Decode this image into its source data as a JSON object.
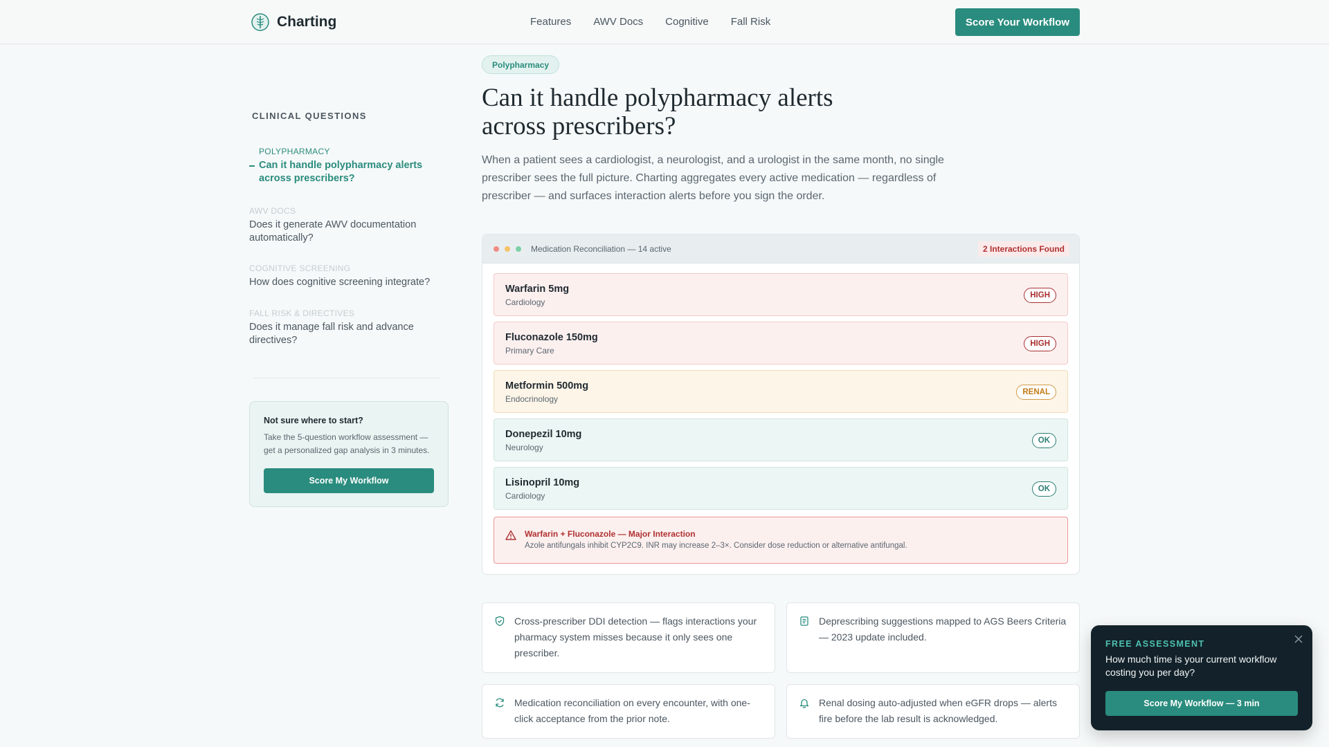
{
  "header": {
    "brand": "Charting",
    "nav": [
      "Features",
      "AWV Docs",
      "Cognitive",
      "Fall Risk"
    ],
    "cta": "Score Your Workflow"
  },
  "sidebar": {
    "heading": "CLINICAL QUESTIONS",
    "items": [
      {
        "category": "POLYPHARMACY",
        "question": "Can it handle polypharmacy alerts across prescribers?"
      },
      {
        "category": "AWV DOCS",
        "question": "Does it generate AWV documentation automatically?"
      },
      {
        "category": "COGNITIVE SCREENING",
        "question": "How does cognitive screening integrate?"
      },
      {
        "category": "FALL RISK & DIRECTIVES",
        "question": "Does it manage fall risk and advance directives?"
      }
    ],
    "help": {
      "title": "Not sure where to start?",
      "text": "Take the 5-question workflow assessment — get a personalized gap analysis in 3 minutes.",
      "button": "Score My Workflow"
    }
  },
  "main": {
    "tag": "Polypharmacy",
    "title": "Can it handle polypharmacy alerts across prescribers?",
    "lead": "When a patient sees a cardiologist, a neurologist, and a urologist in the same month, no single prescriber sees the full picture. Charting aggregates every active medication — regardless of prescriber — and surfaces interaction alerts before you sign the order.",
    "window": {
      "title": "Medication Reconciliation — 14 active",
      "interactions": "2 Interactions Found",
      "dot_colors": [
        "#f28b82",
        "#f6c26b",
        "#7fd0a8"
      ],
      "meds": [
        {
          "name": "Warfarin 5mg",
          "specialty": "Cardiology",
          "badge": "HIGH",
          "level": "high"
        },
        {
          "name": "Fluconazole 150mg",
          "specialty": "Primary Care",
          "badge": "HIGH",
          "level": "high"
        },
        {
          "name": "Metformin 500mg",
          "specialty": "Endocrinology",
          "badge": "RENAL",
          "level": "renal"
        },
        {
          "name": "Donepezil 10mg",
          "specialty": "Neurology",
          "badge": "OK",
          "level": "ok"
        },
        {
          "name": "Lisinopril 10mg",
          "specialty": "Cardiology",
          "badge": "OK",
          "level": "ok"
        }
      ],
      "alert": {
        "title": "Warfarin + Fluconazole — Major Interaction",
        "detail": "Azole antifungals inhibit CYP2C9. INR may increase 2–3×. Consider dose reduction or alternative antifungal."
      }
    },
    "features": [
      {
        "icon": "shield-check-icon",
        "text": "Cross-prescriber DDI detection — flags interactions your pharmacy system misses because it only sees one prescriber."
      },
      {
        "icon": "document-list-icon",
        "text": "Deprescribing suggestions mapped to AGS Beers Criteria — 2023 update included."
      },
      {
        "icon": "refresh-icon",
        "text": "Medication reconciliation on every encounter, with one-click acceptance from the prior note."
      },
      {
        "icon": "bell-icon",
        "text": "Renal dosing auto-adjusted when eGFR drops — alerts fire before the lab result is acknowledged."
      }
    ]
  },
  "toast": {
    "label": "FREE ASSESSMENT",
    "question": "How much time is your current workflow costing you per day?",
    "button": "Score My Workflow — 3 min"
  },
  "colors": {
    "accent": "#2a8c7e",
    "high": "#a92f2f",
    "renal": "#c17a14",
    "ok": "#2a7e72"
  }
}
